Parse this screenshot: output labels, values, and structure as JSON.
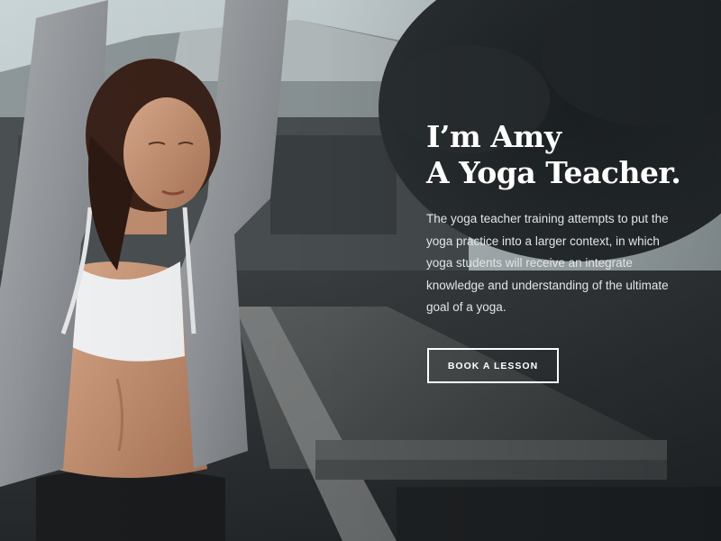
{
  "hero": {
    "title_line1": "I’m Amy",
    "title_line2": "A Yoga Teacher.",
    "description": "The yoga teacher training attempts to put the yoga practice into a larger context, in which yoga students will receive an integrate knowledge and understanding of the ultimate goal of a yoga.",
    "button_label": "BOOK A LESSON"
  },
  "colors": {
    "text_primary": "#ffffff",
    "text_body": "#e3e5e6",
    "background_dark": "#2a2d30"
  }
}
